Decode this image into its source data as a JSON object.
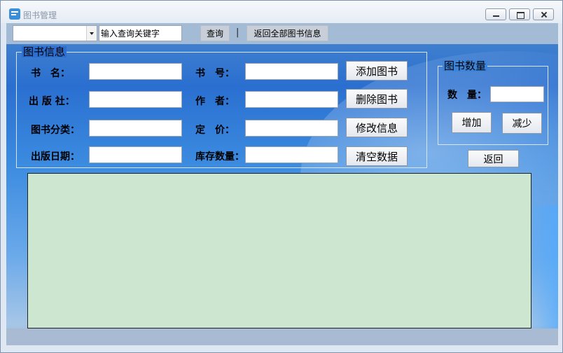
{
  "window": {
    "title": "图书管理"
  },
  "toolbar": {
    "combo_value": "",
    "search_placeholder": "输入查询关键字",
    "query_label": "查询",
    "separator": "|",
    "show_all_label": "返回全部图书信息"
  },
  "book_info": {
    "title": "图书信息",
    "labels": {
      "name": "书　名：",
      "number": "书　号：",
      "publisher": "出 版 社：",
      "author": "作　者：",
      "category": "图书分类：",
      "price": "定　价：",
      "pub_date": "出版日期：",
      "stock": "库存数量："
    },
    "values": {
      "name": "",
      "number": "",
      "publisher": "",
      "author": "",
      "category": "",
      "price": "",
      "pub_date": "",
      "stock": ""
    },
    "buttons": {
      "add": "添加图书",
      "delete": "删除图书",
      "edit": "修改信息",
      "clear": "清空数据"
    }
  },
  "quantity": {
    "title": "图书数量",
    "label": "数　量：",
    "value": "",
    "increase": "增加",
    "decrease": "减少"
  },
  "return_label": "返回",
  "colors": {
    "grid_background": "#cce6d0",
    "toolbar": "#a4bbd6",
    "panel_blue": "#2c6fd0"
  }
}
